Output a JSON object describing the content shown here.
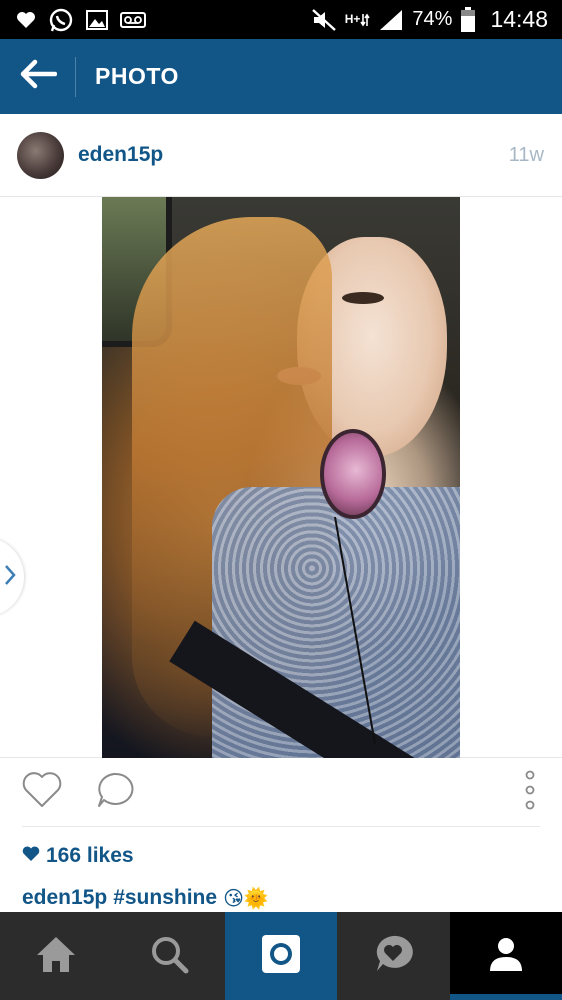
{
  "status_bar": {
    "battery_text": "74%",
    "time": "14:48",
    "network_label_top": "H+",
    "icons": [
      "heart-icon",
      "whatsapp-icon",
      "gallery-icon",
      "voicemail-icon",
      "mute-icon",
      "network-icon",
      "signal-icon",
      "battery-icon"
    ]
  },
  "app_bar": {
    "title": "PHOTO",
    "background_color": "#125688"
  },
  "post": {
    "username": "eden15p",
    "time_ago": "11w",
    "likes_count": "166 likes",
    "caption_username": "eden15p",
    "caption_hashtag": "#sunshine",
    "caption_emojis": "😘🌞"
  },
  "bottom_nav": {
    "tabs": [
      "home",
      "search",
      "camera",
      "activity",
      "profile"
    ],
    "active_tab": "profile"
  }
}
